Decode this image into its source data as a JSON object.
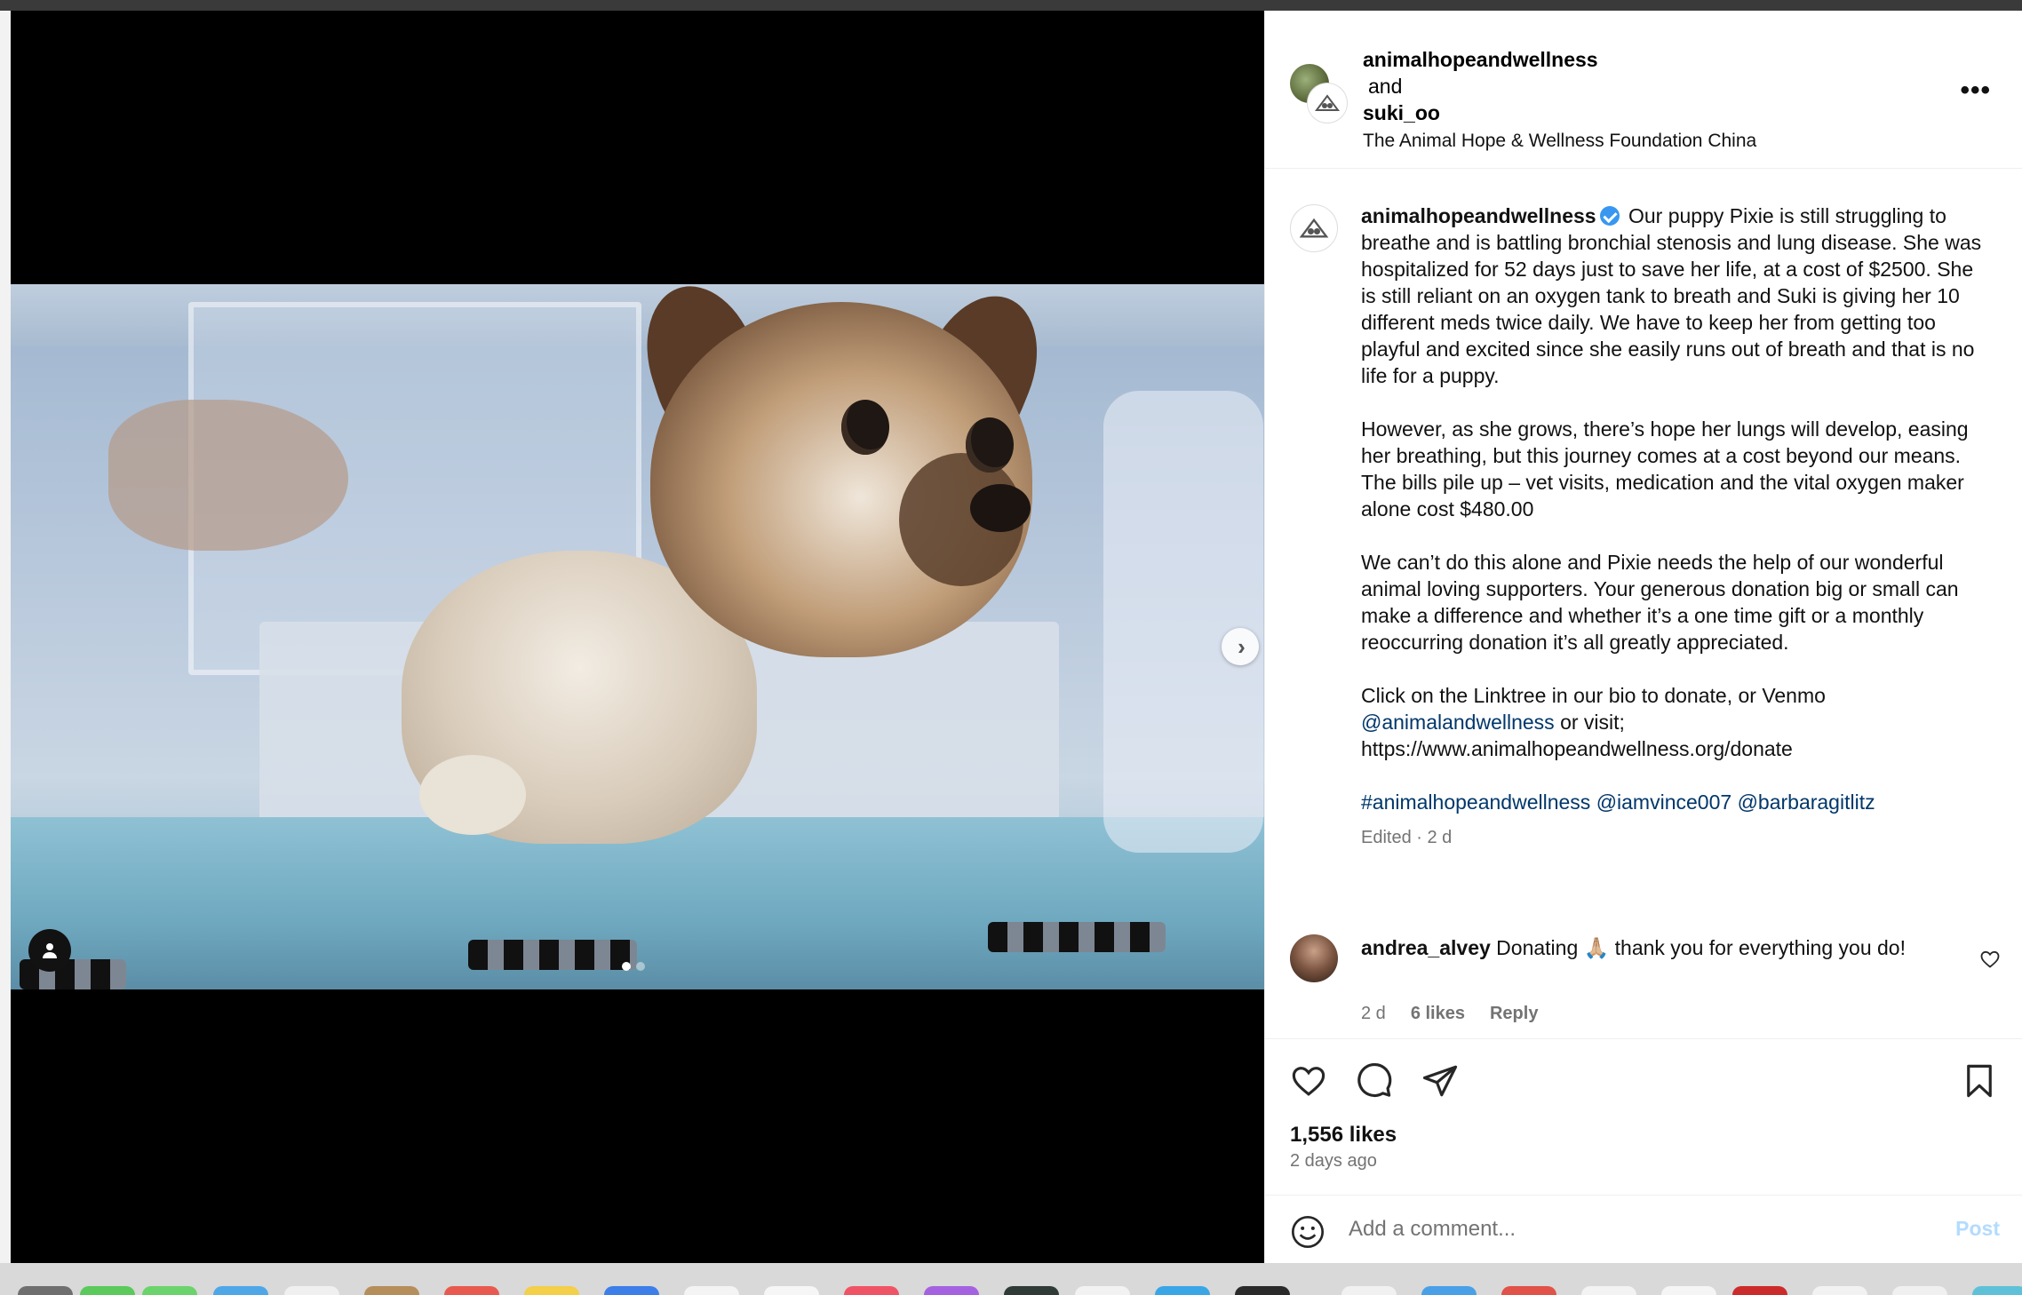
{
  "post": {
    "header": {
      "author": "animalhopeandwellness",
      "conjunction": "and",
      "collaborator": "suki_oo",
      "location": "The Animal Hope & Wellness Foundation China",
      "more_label": "•••"
    },
    "caption": {
      "author": "animalhopeandwellness",
      "para1": "Our puppy Pixie is still struggling to breathe and is battling bronchial stenosis and lung disease. She was hospitalized for 52 days just to save her life, at a cost of $2500. She is still reliant on an oxygen tank to breath and Suki is giving her 10 different meds twice daily. We have to keep her from getting too playful and excited since she easily runs out of breath and that is no life for a puppy.",
      "para2": "However, as she grows, there’s hope her lungs will develop, easing her breathing, but this journey comes at a cost beyond our means. The bills pile up – vet visits, medication and the vital oxygen maker alone cost $480.00",
      "para3": "We can’t do this alone and Pixie needs the help of our wonderful animal loving supporters. Your generous donation big or small can make a difference and whether it’s a one time gift or a monthly reoccurring donation it’s all greatly appreciated.",
      "para4_prefix": "Click on the Linktree in our bio to donate, or Venmo",
      "venmo_mention": "@animalandwellness",
      "para4_mid": "or visit;",
      "url": "https://www.animalhopeandwellness.org/donate",
      "hashtag": "#animalhopeandwellness",
      "mention1": "@iamvince007",
      "mention2": "@barbaragitlitz",
      "meta": "Edited · 2 d"
    },
    "comment": {
      "author": "andrea_alvey",
      "text": "Donating 🙏🏼 thank you for everything you do!",
      "age": "2 d",
      "likes": "6 likes",
      "reply": "Reply"
    },
    "likes_count": "1,556 likes",
    "posted_ago": "2 days ago",
    "add_comment": {
      "placeholder": "Add a comment...",
      "post_label": "Post"
    },
    "carousel": {
      "total": 2,
      "current": 1
    }
  },
  "colors": {
    "link": "#00376b",
    "verified": "#3897f0",
    "post_button_disabled": "#b3dbff",
    "secondary_text": "#737373"
  },
  "icons": {
    "like": "heart-icon",
    "comment": "comment-bubble-icon",
    "share": "paper-plane-icon",
    "save": "bookmark-icon",
    "emoji": "smiley-icon",
    "next": "chevron-right-icon",
    "tags": "person-icon"
  }
}
